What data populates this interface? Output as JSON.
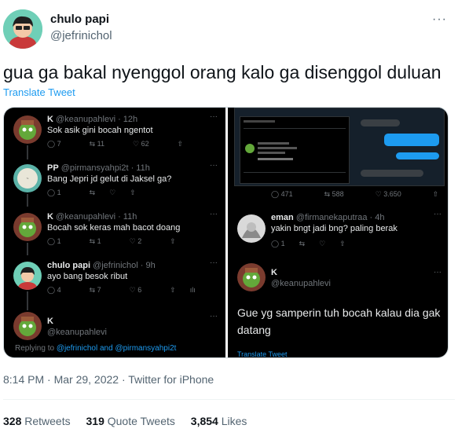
{
  "tweet": {
    "author_name": "chulo papi",
    "author_handle": "@jefrinichol",
    "more_label": "···",
    "text": "gua ga bakal nyenggol orang kalo ga disenggol duluan",
    "translate_label": "Translate Tweet",
    "timestamp": "8:14 PM · Mar 29, 2022 · Twitter for iPhone",
    "stats": {
      "retweets_count": "328",
      "retweets_label": "Retweets",
      "quotes_count": "319",
      "quotes_label": "Quote Tweets",
      "likes_count": "3,854",
      "likes_label": "Likes"
    }
  },
  "screenshot_left": {
    "replies": [
      {
        "name": "K",
        "meta": "@keanupahlevi · 12h",
        "text": "Sok asik gini bocah ngentot",
        "reply": "7",
        "retweet": "11",
        "like": "62"
      },
      {
        "name": "PP",
        "meta": "@pirmansyahpi2t · 11h",
        "text": "Bang Jepri jd gelut di Jaksel ga?",
        "reply": "1",
        "retweet": "",
        "like": ""
      },
      {
        "name": "K",
        "meta": "@keanupahlevi · 11h",
        "text": "Bocah sok keras mah bacot doang",
        "reply": "1",
        "retweet": "1",
        "like": "2"
      },
      {
        "name": "chulo papi",
        "meta": "@jefrinichol · 9h",
        "text": "ayo bang besok ribut",
        "reply": "4",
        "retweet": "7",
        "like": "6"
      },
      {
        "name": "K",
        "meta": "@keanupahlevi",
        "text": "",
        "reply": "",
        "retweet": "",
        "like": ""
      }
    ],
    "replying_prefix": "Replying to",
    "replying_users": "@jefrinichol and @pirmansyahpi2t"
  },
  "screenshot_right": {
    "counts": {
      "reply": "471",
      "retweet": "588",
      "like": "3.650"
    },
    "reply_name": "eman",
    "reply_meta": "@firmanekaputraa · 4h",
    "reply_text": "yakin bngt jadi bng? paling berak",
    "big_name": "K",
    "big_handle": "@keanupahlevi",
    "big_text": "Gue yg samperin tuh bocah kalau dia gak datang",
    "translate_label": "Translate Tweet"
  }
}
